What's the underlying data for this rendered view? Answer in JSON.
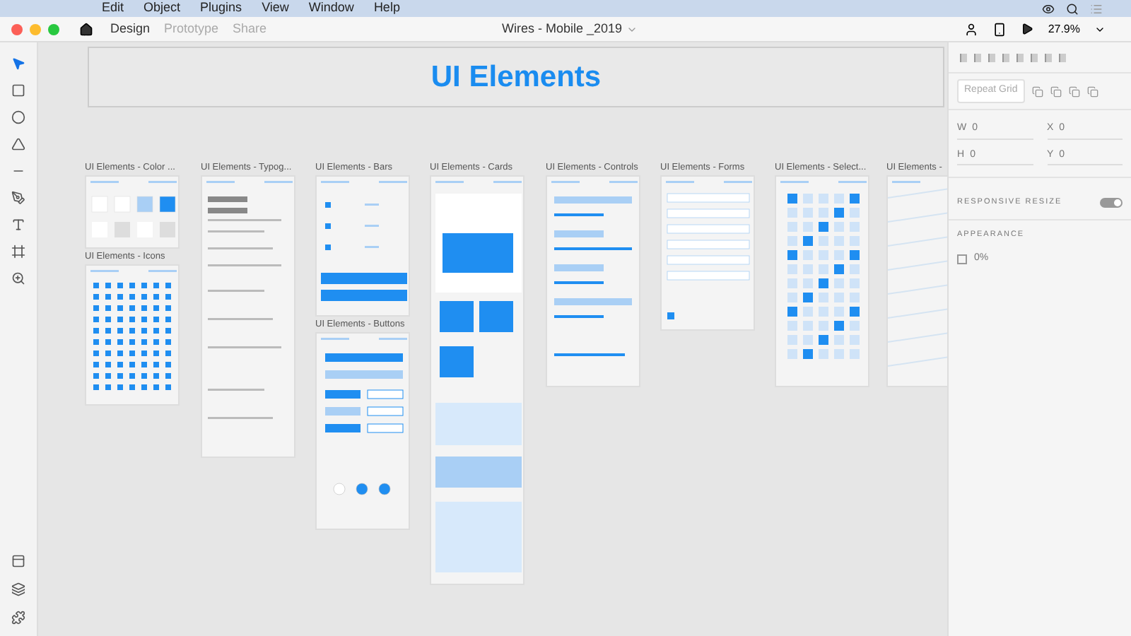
{
  "menu_bar": {
    "items": [
      "Edit",
      "Object",
      "Plugins",
      "View",
      "Window",
      "Help"
    ]
  },
  "title_bar": {
    "tabs": [
      {
        "label": "Design",
        "selected": true
      },
      {
        "label": "Prototype",
        "selected": false
      },
      {
        "label": "Share",
        "selected": false
      }
    ],
    "document_title": "Wires - Mobile _2019",
    "zoom": "27.9%"
  },
  "toolbar": {
    "tools": [
      {
        "kind": "select",
        "selected": true
      },
      {
        "kind": "rectangle",
        "selected": false
      },
      {
        "kind": "ellipse",
        "selected": false
      },
      {
        "kind": "triangle",
        "selected": false
      },
      {
        "kind": "line",
        "selected": false
      },
      {
        "kind": "pen",
        "selected": false
      },
      {
        "kind": "text",
        "selected": false
      },
      {
        "kind": "artboard",
        "selected": false
      },
      {
        "kind": "zoom",
        "selected": false
      }
    ]
  },
  "canvas": {
    "header_board": {
      "title": "UI Elements"
    },
    "artboards": [
      {
        "title": "UI Elements - Color ...",
        "kind": "color"
      },
      {
        "title": "UI Elements - Icons",
        "kind": "icons"
      },
      {
        "title": "UI Elements - Typog...",
        "kind": "typography"
      },
      {
        "title": "UI Elements - Bars",
        "kind": "bars"
      },
      {
        "title": "UI Elements - Buttons",
        "kind": "buttons"
      },
      {
        "title": "UI Elements - Cards",
        "kind": "cards"
      },
      {
        "title": "UI Elements - Controls",
        "kind": "controls"
      },
      {
        "title": "UI Elements - Forms",
        "kind": "forms"
      },
      {
        "title": "UI Elements - Select...",
        "kind": "select"
      },
      {
        "title": "UI Elements -",
        "kind": "map"
      }
    ]
  },
  "properties_panel": {
    "repeat_grid": "Repeat Grid",
    "fields": [
      {
        "label": "W",
        "value": "0"
      },
      {
        "label": "X",
        "value": "0"
      },
      {
        "label": "H",
        "value": "0"
      },
      {
        "label": "Y",
        "value": "0"
      }
    ],
    "responsive_resize": {
      "label": "RESPONSIVE RESIZE",
      "on": true
    },
    "appearance": {
      "label": "APPEARANCE",
      "opacity": "0%"
    }
  }
}
